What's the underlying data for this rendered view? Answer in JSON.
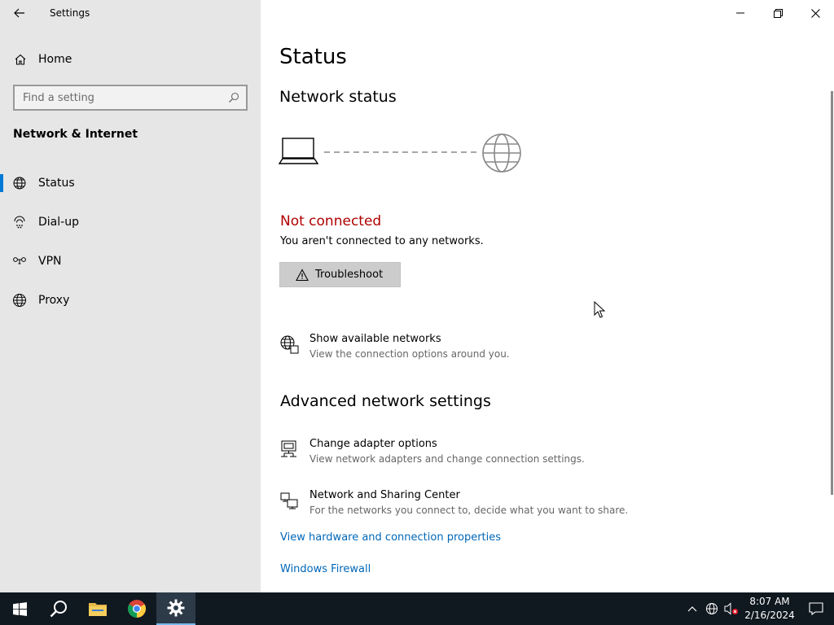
{
  "window": {
    "title": "Settings"
  },
  "sidebar": {
    "home_label": "Home",
    "search_placeholder": "Find a setting",
    "section_heading": "Network & Internet",
    "items": [
      {
        "label": "Status",
        "icon": "globe-status-icon",
        "active": true
      },
      {
        "label": "Dial-up",
        "icon": "dialup-icon",
        "active": false
      },
      {
        "label": "VPN",
        "icon": "vpn-icon",
        "active": false
      },
      {
        "label": "Proxy",
        "icon": "globe-icon",
        "active": false
      }
    ]
  },
  "main": {
    "page_title": "Status",
    "network_status_title": "Network status",
    "connection_status": "Not connected",
    "connection_desc": "You aren't connected to any networks.",
    "troubleshoot_label": "Troubleshoot",
    "show_networks": {
      "title": "Show available networks",
      "desc": "View the connection options around you."
    },
    "advanced_title": "Advanced network settings",
    "adapter_options": {
      "title": "Change adapter options",
      "desc": "View network adapters and change connection settings."
    },
    "sharing_center": {
      "title": "Network and Sharing Center",
      "desc": "For the networks you connect to, decide what you want to share."
    },
    "link_hardware": "View hardware and connection properties",
    "link_firewall": "Windows Firewall"
  },
  "taskbar": {
    "time": "8:07 AM",
    "date": "2/16/2024",
    "apps": [
      "start-icon",
      "search-icon",
      "file-explorer-icon",
      "chrome-icon",
      "settings-icon"
    ]
  },
  "colors": {
    "accent": "#0078d7",
    "error": "#b00000",
    "link": "#0067b8",
    "sidebar_bg": "#e6e6e6",
    "taskbar_bg": "#101820"
  }
}
